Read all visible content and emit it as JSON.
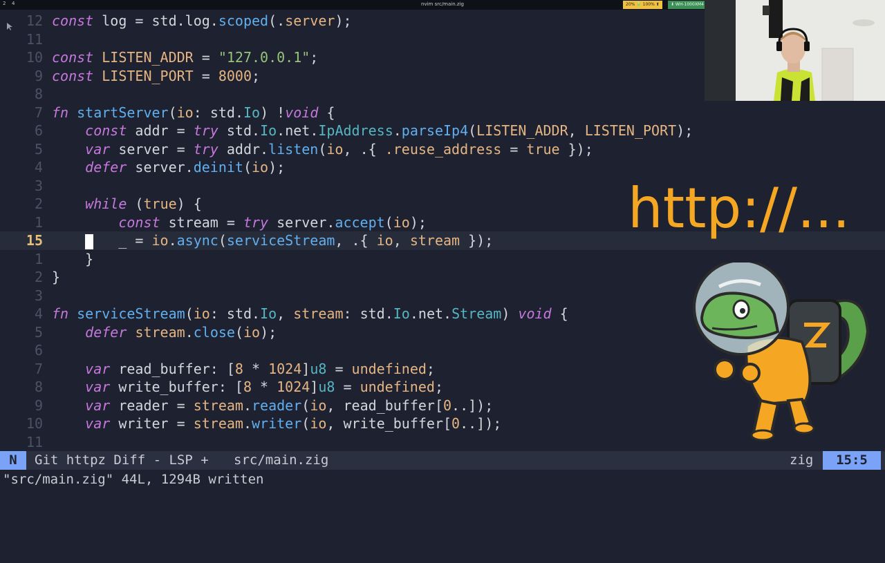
{
  "topbar": {
    "workspace_1": "2",
    "workspace_2": "4",
    "window_title": "nvim src/main.zig",
    "battery": "20% 🔋 100% ⬆",
    "network": "⬇ WH-1000XM4 8"
  },
  "editor": {
    "lines": [
      {
        "num": "12"
      },
      {
        "num": "11"
      },
      {
        "num": "10"
      },
      {
        "num": "9"
      },
      {
        "num": "8"
      },
      {
        "num": "7"
      },
      {
        "num": "6"
      },
      {
        "num": "5"
      },
      {
        "num": "4"
      },
      {
        "num": "3"
      },
      {
        "num": "2"
      },
      {
        "num": "1"
      },
      {
        "num": "15"
      },
      {
        "num": "1"
      },
      {
        "num": "2"
      },
      {
        "num": "3"
      },
      {
        "num": "4"
      },
      {
        "num": "5"
      },
      {
        "num": "6"
      },
      {
        "num": "7"
      },
      {
        "num": "8"
      },
      {
        "num": "9"
      },
      {
        "num": "10"
      },
      {
        "num": "11"
      }
    ],
    "tokens": {
      "l0": [
        "const",
        " log = std.log.",
        "scoped",
        "(.",
        "server",
        ");"
      ],
      "l2": [
        "const",
        " ",
        "LISTEN_ADDR",
        " = ",
        "\"127.0.0.1\"",
        ";"
      ],
      "l3": [
        "const",
        " ",
        "LISTEN_PORT",
        " = ",
        "8000",
        ";"
      ],
      "l5": [
        "fn",
        " ",
        "startServer",
        "(",
        "io",
        ": std.",
        "Io",
        ") !",
        "void",
        " {"
      ],
      "l6": [
        "    ",
        "const",
        " addr = ",
        "try",
        " std.",
        "Io",
        ".net.",
        "IpAddress",
        ".",
        "parseIp4",
        "(",
        "LISTEN_ADDR",
        ", ",
        "LISTEN_PORT",
        ");"
      ],
      "l7": [
        "    ",
        "var",
        " server = ",
        "try",
        " addr.",
        "listen",
        "(",
        "io",
        ", .{ ",
        ".reuse_address",
        " = ",
        "true",
        " });"
      ],
      "l8": [
        "    ",
        "defer",
        " server.",
        "deinit",
        "(",
        "io",
        ");"
      ],
      "l10": [
        "    ",
        "while",
        " (",
        "true",
        ") {"
      ],
      "l11": [
        "        ",
        "const",
        " stream = ",
        "try",
        " server.",
        "accept",
        "(",
        "io",
        ");"
      ],
      "l12": [
        "    ",
        " ",
        "   _ = ",
        "io",
        ".",
        "async",
        "(",
        "serviceStream",
        ", .{ ",
        "io",
        ", ",
        "stream",
        " });"
      ],
      "l13": [
        "    }"
      ],
      "l14": [
        "}"
      ],
      "l16": [
        "fn",
        " ",
        "serviceStream",
        "(",
        "io",
        ": std.",
        "Io",
        ", ",
        "stream",
        ": std.",
        "Io",
        ".net.",
        "Stream",
        ") ",
        "void",
        " {"
      ],
      "l17": [
        "    ",
        "defer",
        " ",
        "stream",
        ".",
        "close",
        "(",
        "io",
        ");"
      ],
      "l19": [
        "    ",
        "var",
        " read_buffer: [",
        "8",
        " * ",
        "1024",
        "]",
        "u8",
        " = ",
        "undefined",
        ";"
      ],
      "l20": [
        "    ",
        "var",
        " write_buffer: [",
        "8",
        " * ",
        "1024",
        "]",
        "u8",
        " = ",
        "undefined",
        ";"
      ],
      "l21": [
        "    ",
        "var",
        " reader = ",
        "stream",
        ".",
        "reader",
        "(",
        "io",
        ", read_buffer[",
        "0",
        "..]);"
      ],
      "l22": [
        "    ",
        "var",
        " writer = ",
        "stream",
        ".",
        "writer",
        "(",
        "io",
        ", write_buffer[",
        "0",
        "..]);"
      ]
    }
  },
  "statusline": {
    "mode": "N",
    "git": "Git httpz Diff - LSP +",
    "file": "src/main.zig",
    "filetype": "zig",
    "position": "15:5"
  },
  "cmdline": {
    "message": "\"src/main.zig\" 44L, 1294B written"
  },
  "overlay": {
    "text": "http://..."
  },
  "colors": {
    "background": "#1e2230",
    "keyword": "#c678dd",
    "function": "#61afef",
    "identifier": "#e5b583",
    "string": "#98c379",
    "type": "#56b6c2",
    "statusline_accent": "#7aa2f7",
    "overlay": "#f5a623"
  },
  "icons": {
    "mascot": "zig-lizard-astronaut-illustration",
    "webcam": "webcam-feed",
    "pointer": "mouse-pointer-icon"
  }
}
